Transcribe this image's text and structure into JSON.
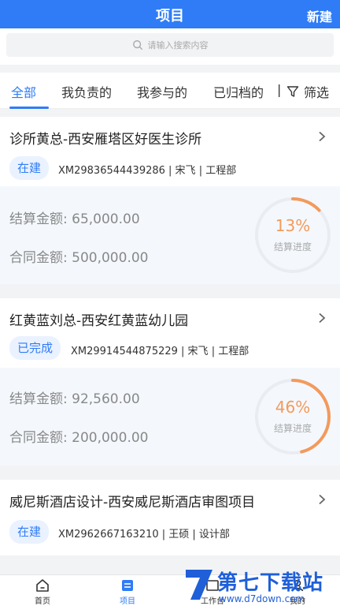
{
  "header": {
    "title": "项目",
    "new_label": "新建"
  },
  "search": {
    "placeholder": "请输入搜索内容"
  },
  "tabs": [
    {
      "label": "全部",
      "active": true
    },
    {
      "label": "我负责的",
      "active": false
    },
    {
      "label": "我参与的",
      "active": false
    },
    {
      "label": "已归档的",
      "active": false
    }
  ],
  "tab_separator": "|",
  "filter_label": "筛选",
  "labels": {
    "settlement": "结算金额:",
    "contract": "合同金额:",
    "progress": "结算进度"
  },
  "projects": [
    {
      "name": "诊所黄总-西安雁塔区好医生诊所",
      "status": "在建",
      "meta": "XM29836544439286 | 宋飞 | 工程部",
      "settlement": "65,000.00",
      "contract": "500,000.00",
      "progress_pct": "13%",
      "progress_fraction": 0.13
    },
    {
      "name": "红黄蓝刘总-西安红黄蓝幼儿园",
      "status": "已完成",
      "meta": "XM29914544875229 | 宋飞 | 工程部",
      "settlement": "92,560.00",
      "contract": "200,000.00",
      "progress_pct": "46%",
      "progress_fraction": 0.46
    },
    {
      "name": "威尼斯酒店设计-西安威尼斯酒店审图项目",
      "status": "在建",
      "meta": "XM2962667163210 | 王硕 | 设计部",
      "settlement": "",
      "contract": "",
      "progress_pct": "",
      "progress_fraction": null
    }
  ],
  "tabbar": [
    {
      "label": "首页",
      "icon": "home-icon",
      "active": false
    },
    {
      "label": "项目",
      "icon": "project-icon",
      "active": true
    },
    {
      "label": "工作台",
      "icon": "workbench-icon",
      "active": false
    },
    {
      "label": "我的",
      "icon": "profile-icon",
      "active": false
    }
  ],
  "watermark": {
    "title": "第七下载站",
    "url": "www.d7down.com"
  },
  "colors": {
    "accent": "#2f7cf6",
    "progress": "#f39a5c",
    "amount_bg": "#f4f8fd"
  }
}
